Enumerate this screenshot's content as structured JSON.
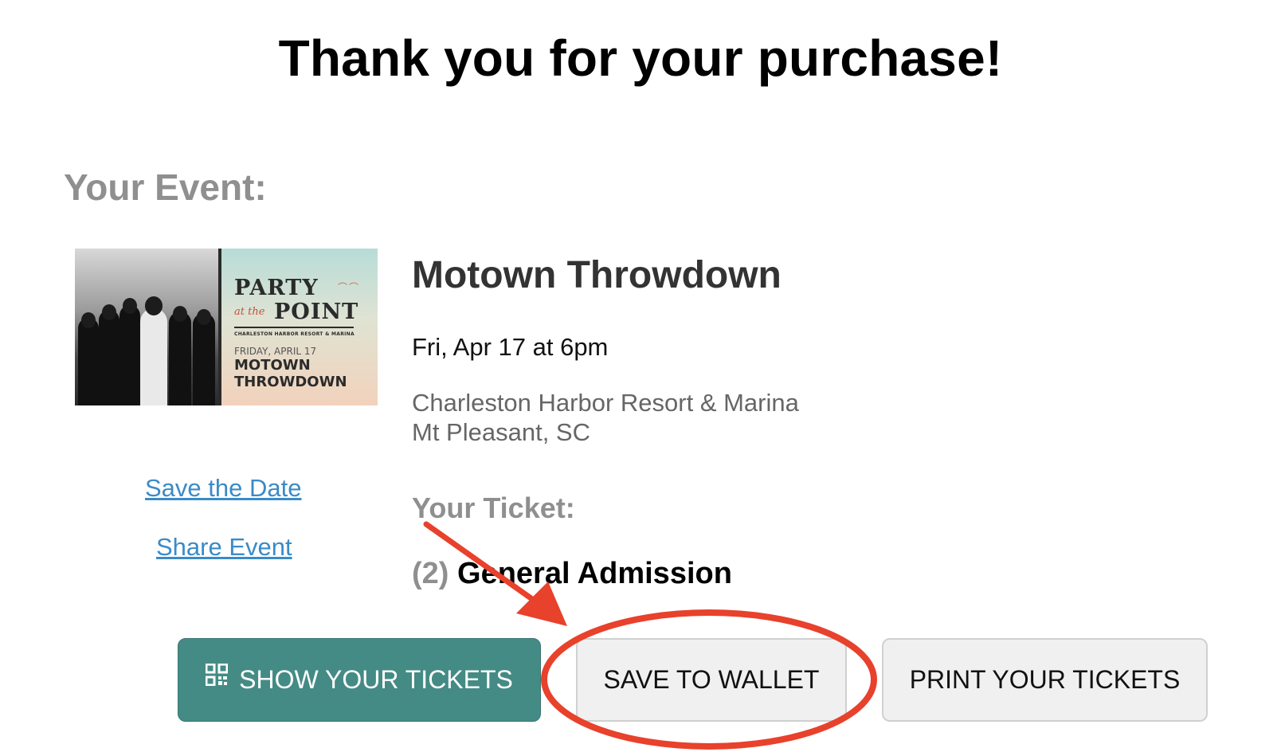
{
  "page": {
    "title": "Thank you for your purchase!",
    "event_heading": "Your Event:"
  },
  "event": {
    "image": {
      "poster_party": "PARTY",
      "poster_at_the": "at the",
      "poster_point": "POINT",
      "poster_venue": "CHARLESTON HARBOR RESORT & MARINA",
      "poster_date": "FRIDAY, APRIL 17",
      "poster_name_line1": "MOTOWN",
      "poster_name_line2": "THROWDOWN"
    },
    "title": "Motown Throwdown",
    "datetime": "Fri, Apr 17 at 6pm",
    "venue_name": "Charleston Harbor Resort & Marina",
    "venue_city": "Mt Pleasant, SC"
  },
  "links": {
    "save_the_date": "Save the Date",
    "share_event": "Share Event"
  },
  "ticket": {
    "heading": "Your Ticket:",
    "quantity": "(2)",
    "type": "General Admission"
  },
  "buttons": {
    "show_tickets": "SHOW YOUR TICKETS",
    "save_to_wallet": "SAVE TO WALLET",
    "print_tickets": "PRINT YOUR TICKETS"
  },
  "colors": {
    "primary_button": "#448b85",
    "link": "#3a8bc7",
    "annotation": "#e8412c",
    "muted_heading": "#8f8f8f"
  },
  "icons": {
    "show_tickets": "qr-code-icon",
    "annotation_arrow": "arrow-icon",
    "annotation_circle": "circle-highlight"
  }
}
